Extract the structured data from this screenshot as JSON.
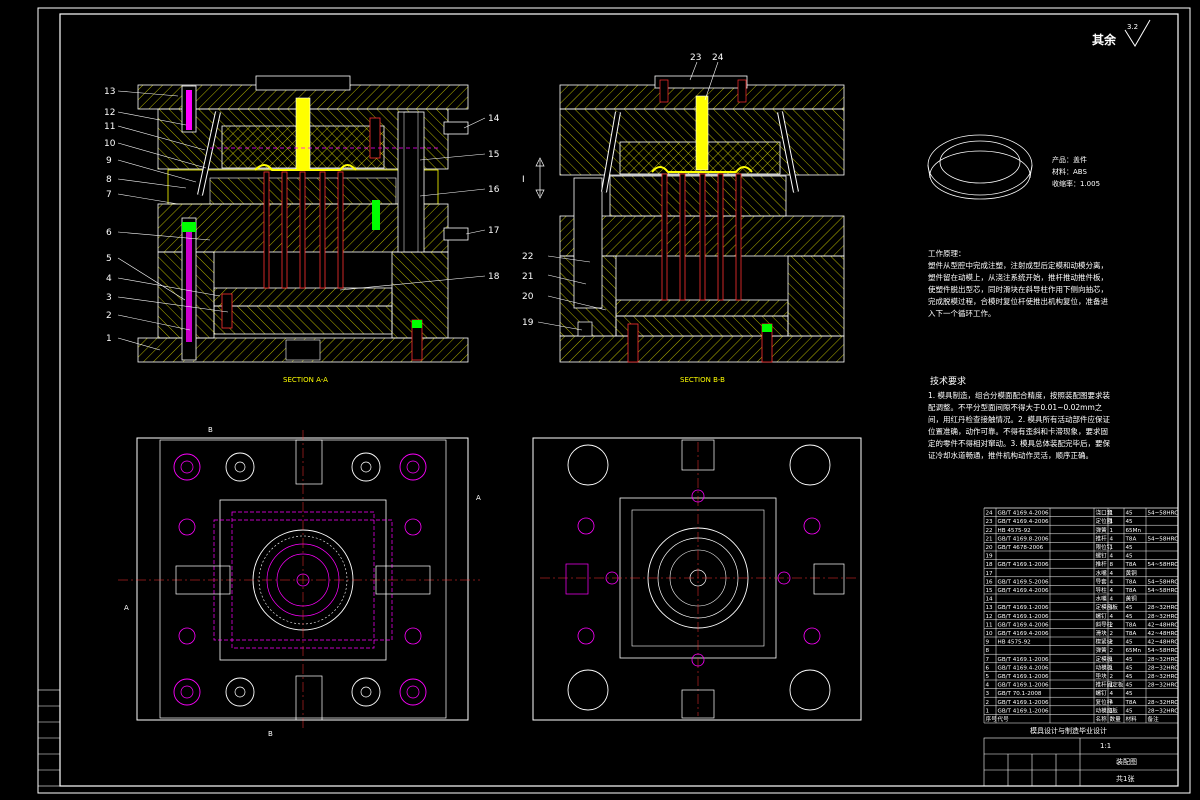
{
  "roughness": {
    "label": "其余",
    "value": "3.2"
  },
  "callouts_left": [
    "13",
    "12",
    "11",
    "10",
    "9",
    "8",
    "7",
    "6",
    "5",
    "4",
    "3",
    "2",
    "1"
  ],
  "callouts_right_a": [
    "14",
    "15",
    "16",
    "17",
    "18"
  ],
  "callouts_b_top": [
    "23",
    "24"
  ],
  "callouts_b_left": [
    "22",
    "21",
    "20",
    "19"
  ],
  "direction_mark": "I",
  "section_a_label": "SECTION A-A",
  "section_b_label": "SECTION B-B",
  "cut_labels": {
    "a_top": "A",
    "a_bottom": "A",
    "b_top": "B",
    "b_bottom": "B"
  },
  "product": {
    "name": "产品：盖件",
    "material": "材料：ABS",
    "shrink": "收缩率：1.005"
  },
  "work_principle_title": "工作原理：",
  "work_principle_text": "塑件从型腔中完成注塑，注射成型后定模和动模分离，塑件留在动模上，从浇注系统开始，推杆推动推件板，使塑件脱出型芯，同时滑块在斜导柱作用下侧向抽芯，完成脱模过程，合模时复位杆使推出机构复位，准备进入下一个循环工作。",
  "tech_title": "技术要求",
  "tech_text": "1. 模具制造，组合分模面配合精度，按照装配图要求装配调整。不平分型面间隙不得大于0.01~0.02mm之间，用红丹检查接触情况。2. 模具所有活动部件应保证位置准确，动作可靠。不得有歪斜和卡滞现象，要求固定的零件不得相对窜动。3. 模具总体装配完毕后，要保证冷却水道畅通，推件机构动作灵活，顺序正确。",
  "bom_rows": [
    [
      "24",
      "GB/T 4169.4-2006",
      "浇口套",
      "1",
      "45",
      "54~58HRC"
    ],
    [
      "23",
      "GB/T 4169.4-2006",
      "定位圈",
      "1",
      "45",
      ""
    ],
    [
      "22",
      "HB 4575-92",
      "弹簧",
      "1",
      "65Mn",
      ""
    ],
    [
      "21",
      "GB/T 4169.8-2006",
      "推杆",
      "4",
      "T8A",
      "54~58HRC"
    ],
    [
      "20",
      "GB/T 4678-2006",
      "限位钉",
      "1",
      "45",
      ""
    ],
    [
      "19",
      "",
      "螺钉",
      "4",
      "45",
      ""
    ],
    [
      "18",
      "GB/T 4169.1-2006",
      "推杆",
      "8",
      "T8A",
      "54~58HRC"
    ],
    [
      "17",
      "",
      "水嘴",
      "4",
      "黄铜",
      ""
    ],
    [
      "16",
      "GB/T 4169.5-2006",
      "导套",
      "4",
      "T8A",
      "54~58HRC"
    ],
    [
      "15",
      "GB/T 4169.4-2006",
      "导柱",
      "4",
      "T8A",
      "54~58HRC"
    ],
    [
      "14",
      "",
      "水嘴",
      "4",
      "黄铜",
      ""
    ],
    [
      "13",
      "GB/T 4169.1-2006",
      "定模座板",
      "1",
      "45",
      "28~32HRC"
    ],
    [
      "12",
      "GB/T 4169.1-2006",
      "螺钉",
      "4",
      "45",
      "28~32HRC"
    ],
    [
      "11",
      "GB/T 4169.4-2006",
      "斜导柱",
      "2",
      "T8A",
      "42~48HRC"
    ],
    [
      "10",
      "GB/T 4169.4-2006",
      "滑块",
      "2",
      "T8A",
      "42~48HRC"
    ],
    [
      "9",
      "HB 4575-92",
      "楔紧块",
      "2",
      "45",
      "42~48HRC"
    ],
    [
      "8",
      "",
      "弹簧",
      "2",
      "65Mn",
      "54~58HRC"
    ],
    [
      "7",
      "GB/T 4169.1-2006",
      "定模板",
      "1",
      "45",
      "28~32HRC"
    ],
    [
      "6",
      "GB/T 4169.4-2006",
      "动模板",
      "1",
      "45",
      "28~32HRC"
    ],
    [
      "5",
      "GB/T 4169.1-2006",
      "垫块",
      "2",
      "45",
      "28~32HRC"
    ],
    [
      "4",
      "GB/T 4169.1-2006",
      "推杆固定板",
      "1",
      "45",
      "28~32HRC"
    ],
    [
      "3",
      "GB/T 70.1-2008",
      "螺钉",
      "4",
      "45",
      ""
    ],
    [
      "2",
      "GB/T 4169.1-2006",
      "复位杆",
      "4",
      "T8A",
      "28~32HRC"
    ],
    [
      "1",
      "GB/T 4169.1-2006",
      "动模座板",
      "1",
      "45",
      "28~32HRC"
    ]
  ],
  "bom_header": [
    "序号",
    "代号",
    "名称",
    "数量",
    "材料",
    "备注"
  ],
  "title_block": {
    "company": "模具设计与制造毕业设计",
    "drawing": "装配图",
    "scale": "1:1",
    "sheet": "共1张"
  },
  "side_strip": [
    "",
    "",
    "",
    "",
    "",
    ""
  ],
  "colors": {
    "background": "#000000",
    "line": "#ffffff",
    "hatch": "#ffff00",
    "hidden": "#ff00ff",
    "red": "#ff3030",
    "green": "#00ff00",
    "cyan": "#00ffff"
  }
}
